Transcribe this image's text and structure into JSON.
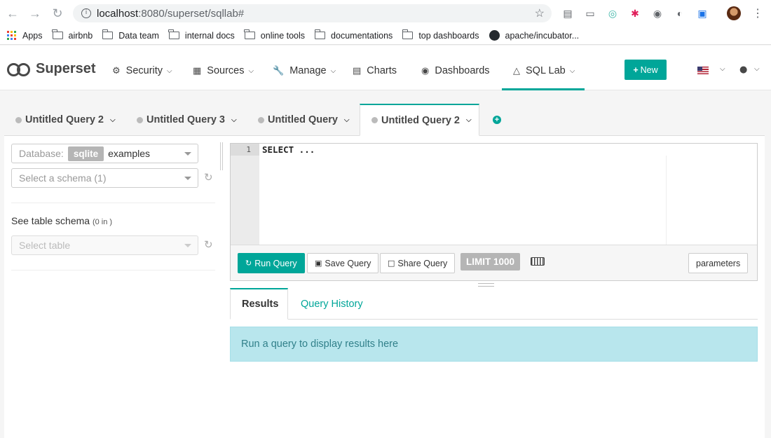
{
  "browser": {
    "url_host": "localhost",
    "url_path": ":8080/superset/sqllab#",
    "bookmarks": [
      {
        "label": "Apps",
        "icon": "apps-grid-icon"
      },
      {
        "label": "airbnb",
        "icon": "folder-icon"
      },
      {
        "label": "Data team",
        "icon": "folder-icon"
      },
      {
        "label": "internal docs",
        "icon": "folder-icon"
      },
      {
        "label": "online tools",
        "icon": "folder-icon"
      },
      {
        "label": "documentations",
        "icon": "folder-icon"
      },
      {
        "label": "top dashboards",
        "icon": "folder-icon"
      },
      {
        "label": "apache/incubator...",
        "icon": "github-icon"
      }
    ]
  },
  "navbar": {
    "brand": "Superset",
    "items": [
      {
        "label": "Security",
        "icon": "cogs-icon",
        "dropdown": true
      },
      {
        "label": "Sources",
        "icon": "table-icon",
        "dropdown": true
      },
      {
        "label": "Manage",
        "icon": "wrench-icon",
        "dropdown": true
      },
      {
        "label": "Charts",
        "icon": "bar-chart-icon",
        "dropdown": false
      },
      {
        "label": "Dashboards",
        "icon": "dashboard-icon",
        "dropdown": false
      },
      {
        "label": "SQL Lab",
        "icon": "flask-icon",
        "dropdown": true
      }
    ],
    "new_label": "New",
    "accent_color": "#00a699"
  },
  "query_tabs": [
    {
      "label": "Untitled Query 2",
      "active": false
    },
    {
      "label": "Untitled Query 3",
      "active": false
    },
    {
      "label": "Untitled Query",
      "active": false
    },
    {
      "label": "Untitled Query 2",
      "active": true
    }
  ],
  "left_panel": {
    "database_label": "Database:",
    "database_backend": "sqlite",
    "database_value": "examples",
    "schema_placeholder": "Select a schema (1)",
    "table_schema_title": "See table schema",
    "table_schema_count": "(0 in )",
    "table_placeholder": "Select table"
  },
  "editor": {
    "line_number": "1",
    "code": "SELECT ..."
  },
  "toolbar": {
    "run_label": "Run Query",
    "save_label": "Save Query",
    "share_label": "Share Query",
    "limit_label": "LIMIT 1000",
    "parameters_label": "parameters"
  },
  "results": {
    "tabs": [
      "Results",
      "Query History"
    ],
    "message": "Run a query to display results here"
  }
}
